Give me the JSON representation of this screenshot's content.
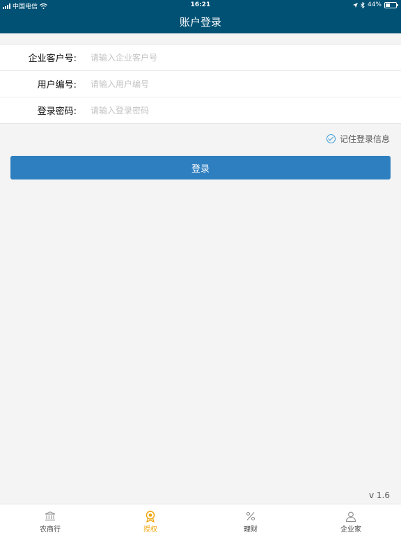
{
  "status_bar": {
    "carrier": "中国电信",
    "time": "16:21",
    "battery": "44%"
  },
  "nav": {
    "title": "账户登录"
  },
  "form": {
    "customer_no": {
      "label": "企业客户号:",
      "placeholder": "请输入企业客户号"
    },
    "user_no": {
      "label": "用户编号:",
      "placeholder": "请输入用户编号"
    },
    "password": {
      "label": "登录密码:",
      "placeholder": "请输入登录密码"
    }
  },
  "remember": {
    "label": "记住登录信息",
    "checked": true
  },
  "login_button": {
    "label": "登录"
  },
  "version": "v 1.6",
  "tabs": [
    {
      "label": "农商行",
      "icon": "bank-icon",
      "active": false
    },
    {
      "label": "授权",
      "icon": "award-icon",
      "active": true
    },
    {
      "label": "理财",
      "icon": "percent-icon",
      "active": false
    },
    {
      "label": "企业家",
      "icon": "user-icon",
      "active": false
    }
  ],
  "colors": {
    "header": "#005174",
    "button": "#2e7fc0",
    "active_tab": "#f0a30a"
  }
}
